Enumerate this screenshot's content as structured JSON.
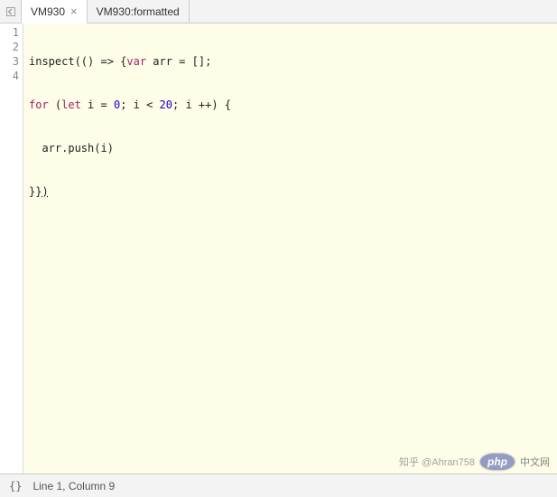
{
  "tabs": [
    {
      "label": "VM930",
      "closable": true,
      "active": true
    },
    {
      "label": "VM930:formatted",
      "closable": false,
      "active": false
    }
  ],
  "nav_back_title": "Back",
  "editor": {
    "lines": [
      {
        "n": "1"
      },
      {
        "n": "2"
      },
      {
        "n": "3"
      },
      {
        "n": "4"
      }
    ],
    "code": {
      "l1": {
        "fn": "inspect",
        "op1": "(() => {",
        "kw": "var",
        "rest": " arr = [];"
      },
      "l2": {
        "kw1": "for",
        "op1": " (",
        "kw2": "let",
        "mid": " i = ",
        "z": "0",
        "sep": "; i < ",
        "twenty": "20",
        "tail": "; i ++) {"
      },
      "l3": {
        "txt": "  arr.push(i)"
      },
      "l4": {
        "a": "}}",
        "b": ")"
      }
    }
  },
  "status": {
    "brackets": "{}",
    "position": "Line 1, Column 9"
  },
  "watermark": {
    "zh": "知乎 @",
    "user": "Ahran758",
    "php": "php",
    "cn": "中文网"
  }
}
